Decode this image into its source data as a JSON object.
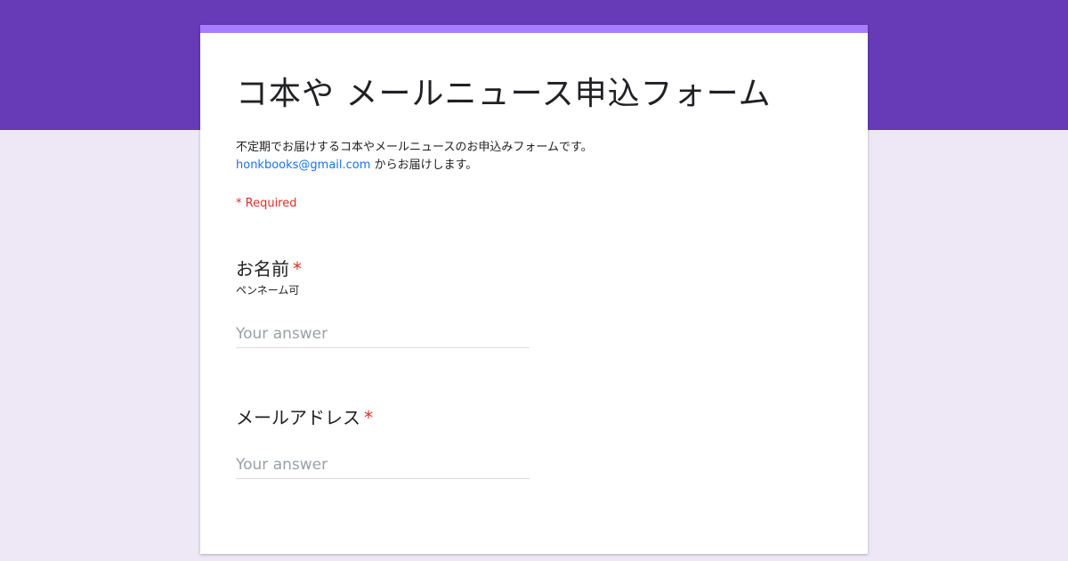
{
  "form": {
    "title": "コ本や メールニュース申込フォーム",
    "description_line1": "不定期でお届けするコ本やメールニュースのお申込みフォームです。",
    "description_email": "honkbooks@gmail.com",
    "description_line2_suffix": " からお届けします。",
    "required_note": "* Required",
    "required_star": "*"
  },
  "questions": [
    {
      "title": "お名前",
      "help": "ペンネーム可",
      "placeholder": "Your answer",
      "value": ""
    },
    {
      "title": "メールアドレス",
      "help": "",
      "placeholder": "Your answer",
      "value": ""
    }
  ],
  "colors": {
    "header_band": "#673ab7",
    "card_accent": "#a77dff",
    "page_background": "#ede7f6",
    "required": "#d93025",
    "link": "#1a73e8"
  }
}
